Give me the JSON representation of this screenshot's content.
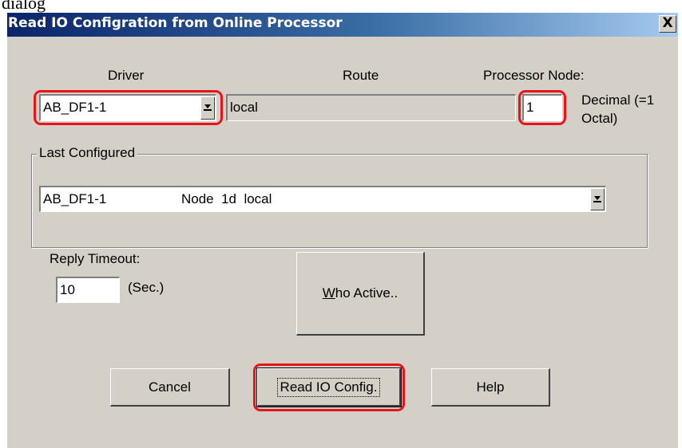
{
  "background_caption": "dialog",
  "window": {
    "title": "Read IO Configration from Online Processor",
    "close_glyph": "X"
  },
  "driver": {
    "label": "Driver",
    "value": "AB_DF1-1",
    "dropdown_icon": "chevron-down-icon"
  },
  "route": {
    "label": "Route",
    "value": "local"
  },
  "processor_node": {
    "label": "Processor Node:",
    "value": "1",
    "note_line1": "Decimal (=1",
    "note_line2": "Octal)"
  },
  "last_configured": {
    "legend": "Last Configured",
    "value_driver": "AB_DF1-1",
    "value_node": "Node  1d  local"
  },
  "reply_timeout": {
    "label": "Reply Timeout:",
    "value": "10",
    "unit": "(Sec.)"
  },
  "buttons": {
    "who_active_mnemonic": "W",
    "who_active_rest": "ho Active..",
    "cancel": "Cancel",
    "read_io_config": "Read IO Config.",
    "help": "Help"
  },
  "highlight_color": "#e8141c"
}
